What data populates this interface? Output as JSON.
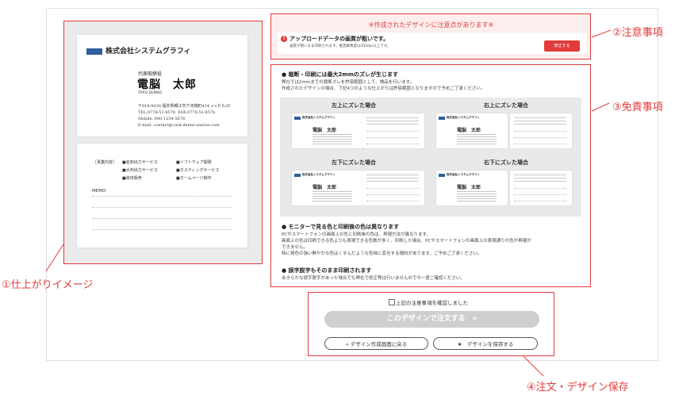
{
  "card_front": {
    "company": "株式会社システムグラフィ",
    "title": "代表取締役",
    "name": "電脳　太郎",
    "name_en": "TARO DENNO",
    "address": "〒918-0038 福井県鯖江市下河端町414 ××ビル2F\nTEL.0778-51-8578  FAX.0778-51-8576\nMobile. 000-1234-5678\nE-mail. contact@card.denno-saurus.com"
  },
  "card_back": {
    "business_head": "［事業内容］",
    "services": [
      "■名刺出力サービス",
      "■ソフトウェア開発",
      "■大判出力サービス",
      "■ホスティングサービス",
      "■資材販売",
      "■ホームページ制作"
    ],
    "memo": "MEMO"
  },
  "notice": {
    "header": "※作成されたデザインに注意点があります※",
    "warn_title": "アップロードデータの画質が粗いです。",
    "warn_sub": "画質が粗いまま印刷されます。推奨解像度は350dpi以上です。",
    "fix_button": "修正する"
  },
  "disclaimer": {
    "h1": "● 裁断・印刷には最大2mmのズレが生じます",
    "t1a": "弊社では2mmまでの裁断ズレを許容範囲として、検品を行います。",
    "t1b": "作成されたデザインの場合、下記4つのような仕上がりは許容範囲となりますので予めご了承ください。",
    "shift_labels": [
      "左上にズレた場合",
      "右上にズレた場合",
      "左下にズレた場合",
      "右下にズレた場合"
    ],
    "mini_company": "株式会社システムグラフィ",
    "mini_name": "電脳　太郎",
    "h2": "● モニターで見る色と印刷後の色は異なります",
    "t2a": "PCやスマートフォンの画面上の色と印刷後の色は、再現方法が異なります。",
    "t2b": "画面上の色は印刷できる色よりも表現できる色数が多く、印刷した場合、PCやスマートフォンの画面上の表現通りの色が再現が",
    "t2c": "できません。",
    "t2d": "特に発色の強い鮮やかな色はくすんだような色味に変化する傾向があります。ご予めご了承ください。",
    "h3": "● 誤字脱字もそのまま印刷されます",
    "t3": "あきらかな誤字脱字があった場合でも弊社で修正等は行いませんので今一度ご確認ください。"
  },
  "order": {
    "confirm_label": "上記の注意事項を確認しました",
    "confirm_checked": false,
    "order_button": "このデザインで注文する　»",
    "back_button": "«  デザイン作成画面に戻る",
    "save_button": "★　デザインを保存する"
  },
  "callouts": {
    "c1": "①仕上がりイメージ",
    "c2": "②注意事項",
    "c3": "③免責事項",
    "c4": "④注文・デザイン保存"
  },
  "colors": {
    "accent_red": "#e23b3b",
    "logo_blue": "#2f5f9c",
    "disabled_button": "#cfcfcf"
  }
}
